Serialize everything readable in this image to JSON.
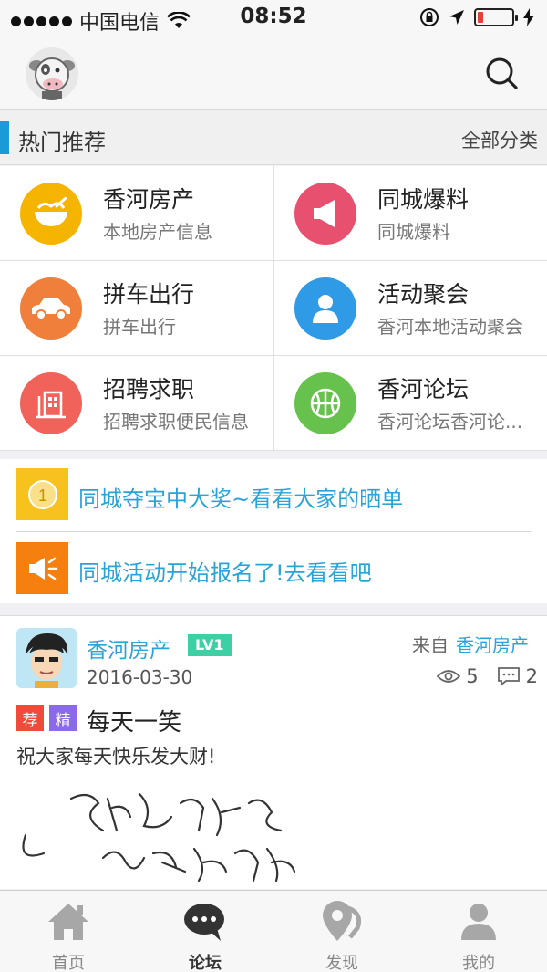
{
  "status_bar": {
    "carrier": "中国电信",
    "time": "08:52"
  },
  "header": {
    "avatar_icon": "cow-mascot-avatar",
    "search_icon": "search-icon"
  },
  "hot": {
    "title": "热门推荐",
    "all_categories": "全部分类"
  },
  "categories": [
    {
      "name": "香河房产",
      "desc": "本地房产信息",
      "icon": "bowl-icon",
      "color": "#f5b400"
    },
    {
      "name": "同城爆料",
      "desc": "同城爆料",
      "icon": "megaphone-icon",
      "color": "#e8506f"
    },
    {
      "name": "拼车出行",
      "desc": "拼车出行",
      "icon": "car-icon",
      "color": "#ef7f3a"
    },
    {
      "name": "活动聚会",
      "desc": "香河本地活动聚会",
      "icon": "person-icon",
      "color": "#2f9ae6"
    },
    {
      "name": "招聘求职",
      "desc": "招聘求职便民信息",
      "icon": "building-icon",
      "color": "#f0625a"
    },
    {
      "name": "香河论坛",
      "desc": "香河论坛香河论...",
      "icon": "ball-icon",
      "color": "#66c14d"
    }
  ],
  "notices": [
    {
      "text": "同城夺宝中大奖~看看大家的晒单",
      "icon": "coin-icon",
      "color": "#f7c21e",
      "badge": "1"
    },
    {
      "text": "同城活动开始报名了!去看看吧",
      "icon": "speaker-icon",
      "color": "#f6800f"
    }
  ],
  "post": {
    "author": "香河房产",
    "level": "LV1",
    "from_label": "来自",
    "from_forum": "香河房产",
    "date": "2016-03-30",
    "views": "5",
    "comments": "2",
    "tag_recommend": "荐",
    "tag_elite": "精",
    "title": "每天一笑",
    "body": "祝大家每天快乐发大财!"
  },
  "tabs": [
    {
      "label": "首页",
      "icon": "home-icon",
      "active": false
    },
    {
      "label": "论坛",
      "icon": "chat-icon",
      "active": true
    },
    {
      "label": "发现",
      "icon": "location-icon",
      "active": false
    },
    {
      "label": "我的",
      "icon": "user-icon",
      "active": false
    }
  ]
}
